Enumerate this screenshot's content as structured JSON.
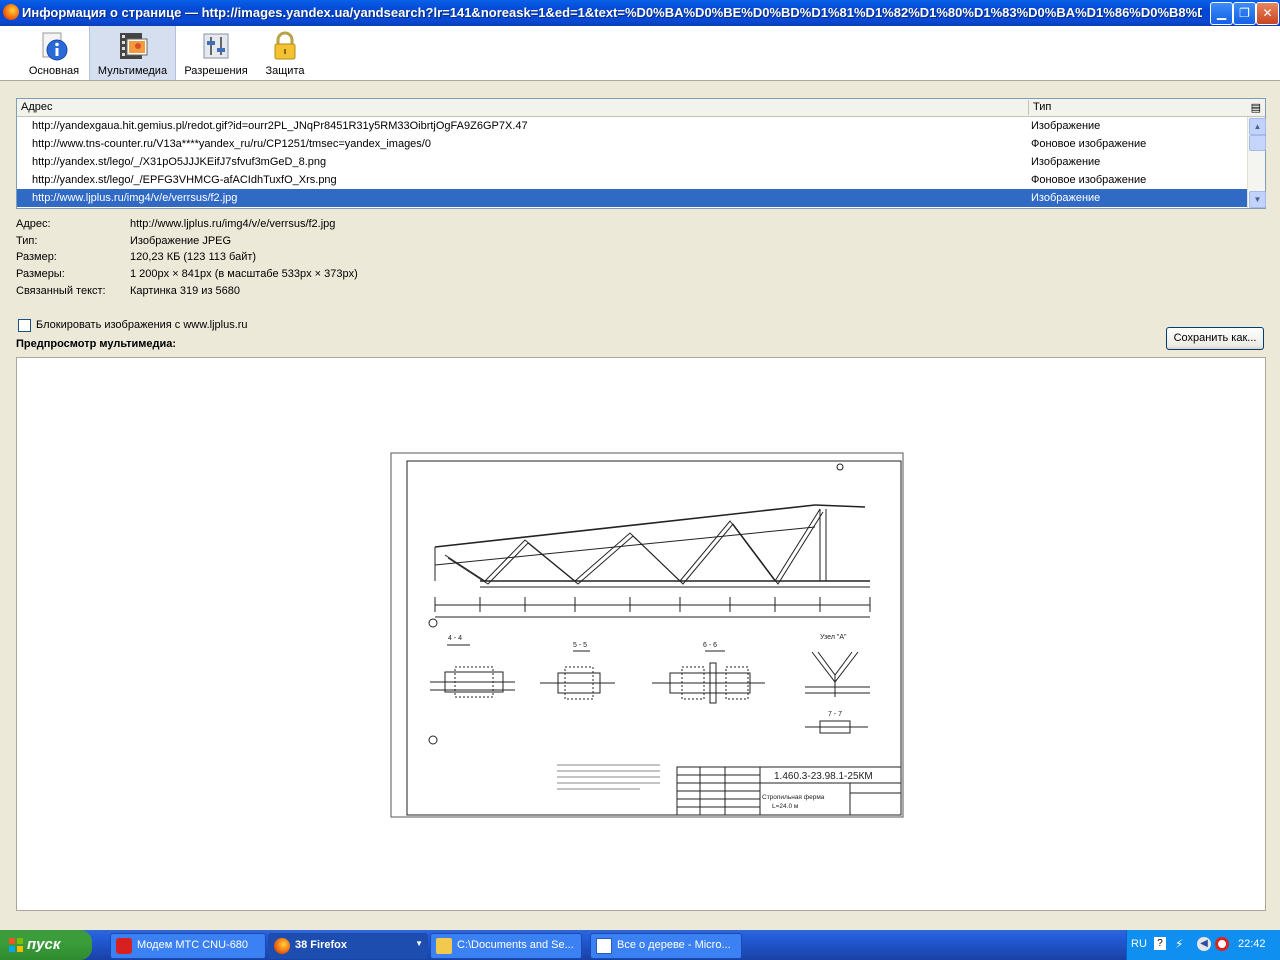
{
  "window": {
    "title": "Информация о странице — http://images.yandex.ua/yandsearch?lr=141&noreask=1&ed=1&text=%D0%BA%D0%BE%D0%BD%D1%81%D1%82%D1%80%D1%83%D0%BA%D1%86%D0%B8%D0%B..."
  },
  "toolbar": {
    "tabs": [
      {
        "label": "Основная"
      },
      {
        "label": "Мультимедиа"
      },
      {
        "label": "Разрешения"
      },
      {
        "label": "Защита"
      }
    ]
  },
  "media_list": {
    "col_address": "Адрес",
    "col_type": "Тип",
    "rows": [
      {
        "address": "http://yandexgaua.hit.gemius.pl/redot.gif?id=ourr2PL_JNqPr8451R31y5RM33OibrtjOgFA9Z6GP7X.47",
        "type": "Изображение"
      },
      {
        "address": "http://www.tns-counter.ru/V13a****yandex_ru/ru/CP1251/tmsec=yandex_images/0",
        "type": "Фоновое изображение"
      },
      {
        "address": "http://yandex.st/lego/_/X31pO5JJJKEifJ7sfvuf3mGeD_8.png",
        "type": "Изображение"
      },
      {
        "address": "http://yandex.st/lego/_/EPFG3VHMCG-afACIdhTuxfO_Xrs.png",
        "type": "Фоновое изображение"
      },
      {
        "address": "http://www.ljplus.ru/img4/v/e/verrsus/f2.jpg",
        "type": "Изображение"
      }
    ]
  },
  "details": {
    "address_label": "Адрес:",
    "address": "http://www.ljplus.ru/img4/v/e/verrsus/f2.jpg",
    "type_label": "Тип:",
    "type": "Изображение JPEG",
    "size_label": "Размер:",
    "size": "120,23 КБ (123 113 байт)",
    "dims_label": "Размеры:",
    "dims": "1 200px × 841px (в масштабе 533px × 373px)",
    "alt_label": "Связанный текст:",
    "alt": "Картинка 319 из 5680"
  },
  "block_label": "Блокировать изображения с www.ljplus.ru",
  "preview_label": "Предпросмотр мультимедиа:",
  "save_label": "Сохранить как...",
  "drawing": {
    "code": "1.460.3-23.98.1-25КМ",
    "name": "Стропильная ферма",
    "span": "L=24.0 м",
    "node_label": "Узел \"А\"",
    "sec44": "4 - 4",
    "sec55": "5 - 5",
    "sec66": "6 - 6",
    "sec77": "7 - 7"
  },
  "taskbar": {
    "start": "пуск",
    "items": [
      {
        "label": "Модем МТС CNU-680"
      },
      {
        "label": "38 Firefox"
      },
      {
        "label": "C:\\Documents and Se..."
      },
      {
        "label": "Все о дереве - Micro..."
      }
    ],
    "lang": "RU",
    "clock": "22:42"
  },
  "colors": {
    "selection": "#316ac5",
    "titlebar": "#0245d1",
    "taskbar": "#245edb",
    "start": "#3a9e3a"
  }
}
